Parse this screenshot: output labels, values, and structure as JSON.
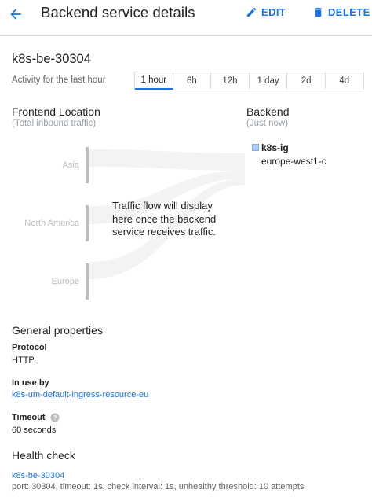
{
  "header": {
    "title": "Backend service details",
    "edit_label": "EDIT",
    "delete_label": "DELETE"
  },
  "resource": {
    "name": "k8s-be-30304"
  },
  "activity": {
    "label": "Activity for the last hour",
    "tabs": [
      "1 hour",
      "6h",
      "12h",
      "1 day",
      "2d",
      "4d"
    ],
    "active_tab": "1 hour"
  },
  "frontend": {
    "title": "Frontend Location",
    "subtitle": "(Total inbound traffic)",
    "regions": [
      "Asia",
      "North America",
      "Europe"
    ]
  },
  "backend": {
    "title": "Backend",
    "subtitle": "(Just now)",
    "instance_group": {
      "name": "k8s-ig",
      "zone": "europe-west1-c"
    }
  },
  "traffic_message": "Traffic flow will display here once the backend service receives traffic.",
  "general": {
    "title": "General properties",
    "protocol_label": "Protocol",
    "protocol_value": "HTTP",
    "in_use_label": "In use by",
    "in_use_value": "k8s-um-default-ingress-resource-eu",
    "timeout_label": "Timeout",
    "timeout_value": "60 seconds"
  },
  "health_check": {
    "title": "Health check",
    "name": "k8s-be-30304",
    "details": "port: 30304, timeout: 1s, check interval: 1s, unhealthy threshold: 10 attempts"
  },
  "colors": {
    "accent": "#1a73e8",
    "muted": "#bdbdbd"
  }
}
